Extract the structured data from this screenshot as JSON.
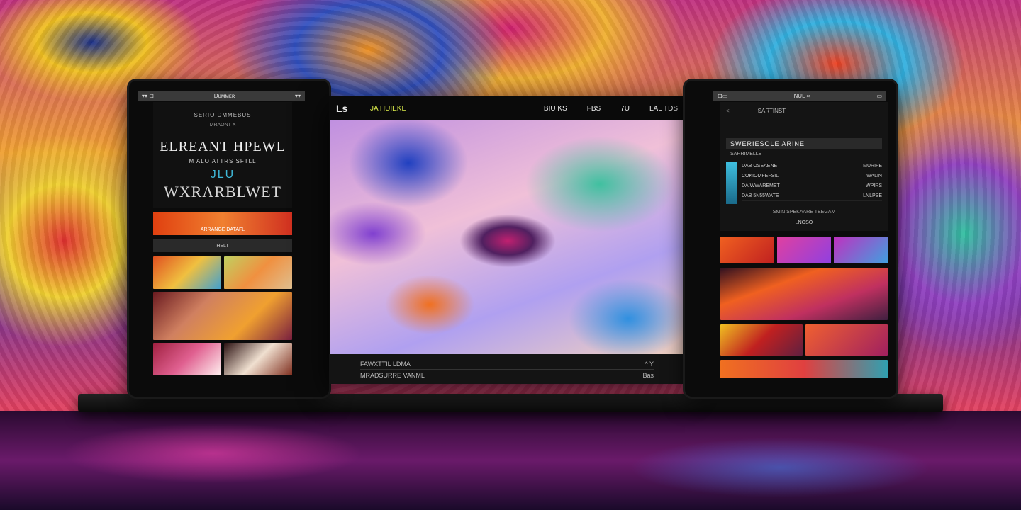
{
  "left_phone": {
    "status_left": "▾▾ ⊡",
    "status_title": "Dᴜᴍᴍᴇʀ",
    "status_right": "▾▾",
    "kicker": "SERIO DMMEBUS",
    "sub": "MRAONT  X",
    "title": "ELREANT HPEWL",
    "line": "M ALO ATTRS SFTLL",
    "accent": "JLU",
    "title2": "WXRARBLWET",
    "strip_label": "ARRANGE DATAFL",
    "button": "HELT"
  },
  "center_monitor": {
    "logo": "Ls",
    "brand": "JA HUIEKE",
    "nav": [
      "BIU KS",
      "FBS",
      "7U",
      "LAL TDS"
    ],
    "caption_line1": "FAWXTTIL LDMA",
    "caption_line1_right": "^ Y",
    "caption_line2": "MRADSURRE VANML",
    "caption_line2_right": "Bas"
  },
  "right_phone": {
    "status_left": "⊡▭",
    "status_title": "NUL ∞",
    "status_right": "▭",
    "header": "SARTINST",
    "header_arrow": "<",
    "list_title": "SWERIESOLE ARINE",
    "list_sub": "SARRIMELLE",
    "rows": [
      {
        "label": "DAB OSEAENE",
        "value": "MURIFE"
      },
      {
        "label": "COKIOMFEFSIL",
        "value": "WALIN"
      },
      {
        "label": "DA.WWAREMET",
        "value": "WPIRS"
      },
      {
        "label": "DAB 5N55WATE",
        "value": "LNLPSE"
      }
    ],
    "foot": "SMIN SPEKAARE   TEEGAM",
    "link": "LNOSO"
  },
  "colors": {
    "accent_cyan": "#3fb8d8",
    "brand_yellow": "#d8e84a"
  }
}
